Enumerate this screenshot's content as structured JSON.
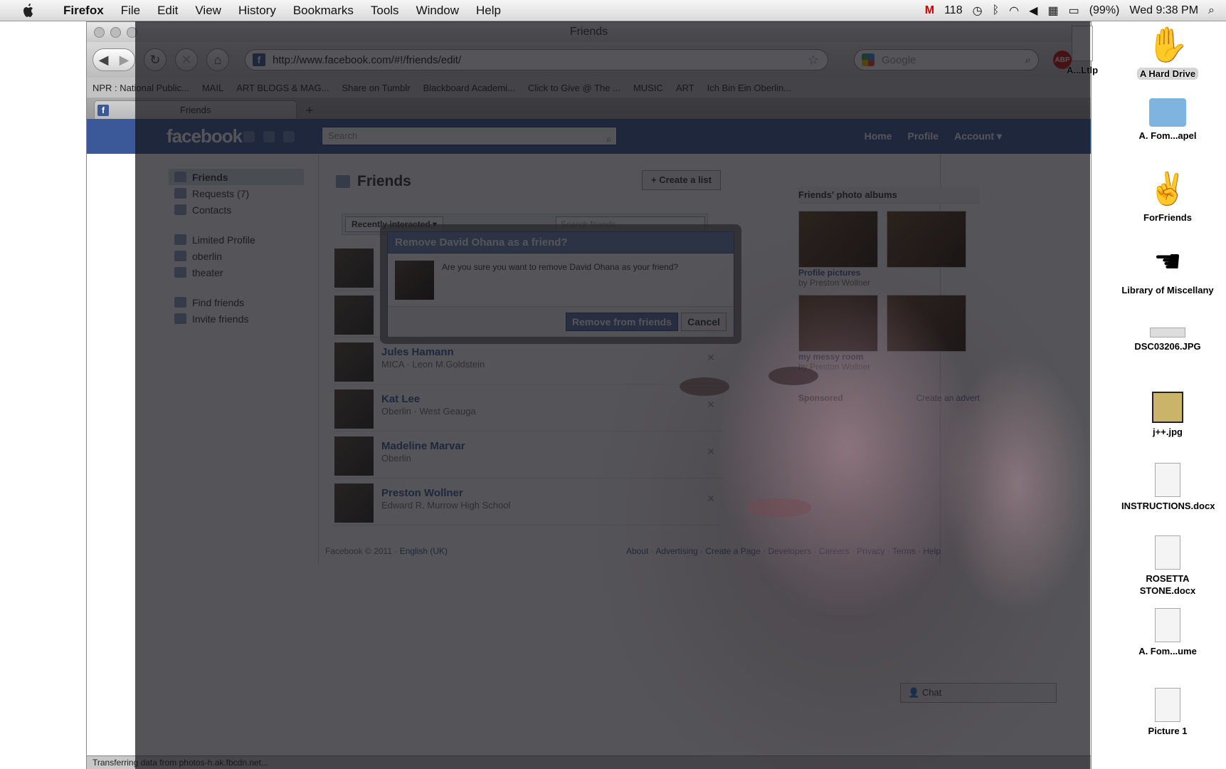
{
  "menubar": {
    "app": "Firefox",
    "items": [
      "File",
      "Edit",
      "View",
      "History",
      "Bookmarks",
      "Tools",
      "Window",
      "Help"
    ],
    "mail_count": "118",
    "battery": "(99%)",
    "clock": "Wed 9:38 PM"
  },
  "window": {
    "title": "Friends",
    "url": "http://www.facebook.com/#!/friends/edit/",
    "search_placeholder": "Google",
    "bookmarks": [
      "NPR : National Public...",
      "MAIL",
      "ART BLOGS & MAG...",
      "Share on Tumblr",
      "Blackboard Academi...",
      "Click to Give @ The ...",
      "MUSIC",
      "ART",
      "Ich Bin Ein Oberlin..."
    ],
    "tab_title": "Friends",
    "status": "Transferring data from photos-h.ak.fbcdn.net..."
  },
  "facebook": {
    "logo": "facebook",
    "search_placeholder": "Search",
    "nav": [
      "Home",
      "Profile",
      "Account"
    ],
    "leftnav": [
      {
        "label": "Friends",
        "selected": true
      },
      {
        "label": "Requests (7)",
        "selected": false
      },
      {
        "label": "Contacts",
        "selected": false
      }
    ],
    "lists": [
      "Limited Profile",
      "oberlin",
      "theater"
    ],
    "tools": [
      "Find friends",
      "Invite friends"
    ],
    "heading": "Friends",
    "create_list": "+ Create a list",
    "filter": "Recently interacted",
    "search_friends": "Search friends",
    "friends": [
      {
        "name": "Jules Hamann",
        "sub": "MICA · Leon M.Goldstein"
      },
      {
        "name": "Kat Lee",
        "sub": "Oberlin · West Geauga"
      },
      {
        "name": "Madeline Marvar",
        "sub": "Oberlin"
      },
      {
        "name": "Preston Wollner",
        "sub": "Edward R. Murrow High School"
      }
    ],
    "albums_heading": "Friends' photo albums",
    "albums": [
      {
        "title": "Profile pictures",
        "by": "by Preston Wollner"
      },
      {
        "title": "my messy room",
        "by": "by Preston Wollner"
      }
    ],
    "sponsored": "Sponsored",
    "create_advert": "Create an advert",
    "footer_left": "Facebook © 2011 · ",
    "footer_lang": "English (UK)",
    "footer_links": [
      "About",
      "Advertising",
      "Create a Page",
      "Developers",
      "Careers",
      "Privacy",
      "Terms",
      "Help"
    ],
    "chat": "Chat"
  },
  "dialog": {
    "title": "Remove David Ohana as a friend?",
    "message": "Are you sure you want to remove David Ohana as your friend?",
    "confirm": "Remove from friends",
    "cancel": "Cancel"
  },
  "desktop": [
    {
      "label": "A...Ltlp"
    },
    {
      "label": "A Hard Drive"
    },
    {
      "label": "A. Fom...apel"
    },
    {
      "label": "ForFriends"
    },
    {
      "label": "Library of Miscellany"
    },
    {
      "label": "DSC03206.JPG"
    },
    {
      "label": "j++.jpg"
    },
    {
      "label": "INSTRUCTIONS.docx"
    },
    {
      "label": "ROSETTA STONE.docx"
    },
    {
      "label": "A. Fom...ume"
    },
    {
      "label": "Picture 1"
    }
  ]
}
